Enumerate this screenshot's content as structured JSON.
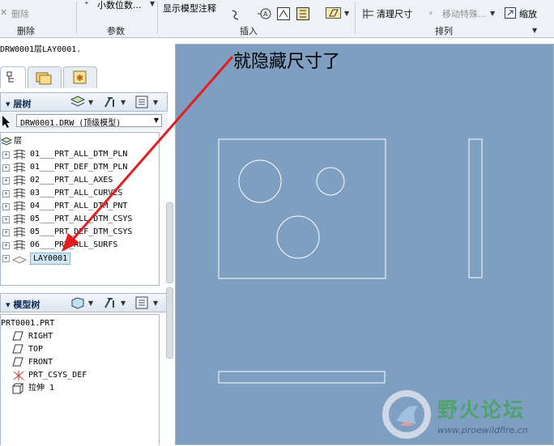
{
  "ribbon": {
    "delete_label": "删除",
    "decimals_label": "小数位数...",
    "show_model_annotation_label": "显示模型注释",
    "cleanup_dims_label": "清理尺寸",
    "move_special_label": "移动特殊...",
    "zoom_label": "缩放",
    "groups": {
      "delete": "删除",
      "params": "参数",
      "insert": "插入",
      "arrange": "排列"
    }
  },
  "breadcrumb": "DRW0001层LAY0001.",
  "layer_tree": {
    "title": "层树",
    "model_select": "DRW0001.DRW (顶级模型)",
    "root_label": "层",
    "items": [
      "01___PRT_ALL_DTM_PLN",
      "01___PRT_DEF_DTM_PLN",
      "02___PRT_ALL_AXES",
      "03___PRT_ALL_CURVES",
      "04___PRT_ALL_DTM_PNT",
      "05___PRT_ALL_DTM_CSYS",
      "05___PRT_DEF_DTM_CSYS",
      "06___PRT_ALL_SURFS",
      "LAY0001"
    ],
    "selected_index": 8
  },
  "model_tree": {
    "title": "模型树",
    "root_label": "PRT0001.PRT",
    "items": [
      {
        "label": "RIGHT",
        "icon": "datum-plane-icon"
      },
      {
        "label": "TOP",
        "icon": "datum-plane-icon"
      },
      {
        "label": "FRONT",
        "icon": "datum-plane-icon"
      },
      {
        "label": "PRT_CSYS_DEF",
        "icon": "coordinate-system-icon"
      },
      {
        "label": "拉伸 1",
        "icon": "extrude-icon"
      }
    ]
  },
  "annotation": {
    "text": "就隐藏尺寸了",
    "arrow_color": "#e31e1e"
  },
  "watermark": {
    "text": "野火论坛",
    "url": "www.proewildfire.cn"
  },
  "colors": {
    "canvas_bg": "#7e9fc2",
    "drawing_lines": "#ffffff",
    "selection": "#cfe6f5"
  }
}
